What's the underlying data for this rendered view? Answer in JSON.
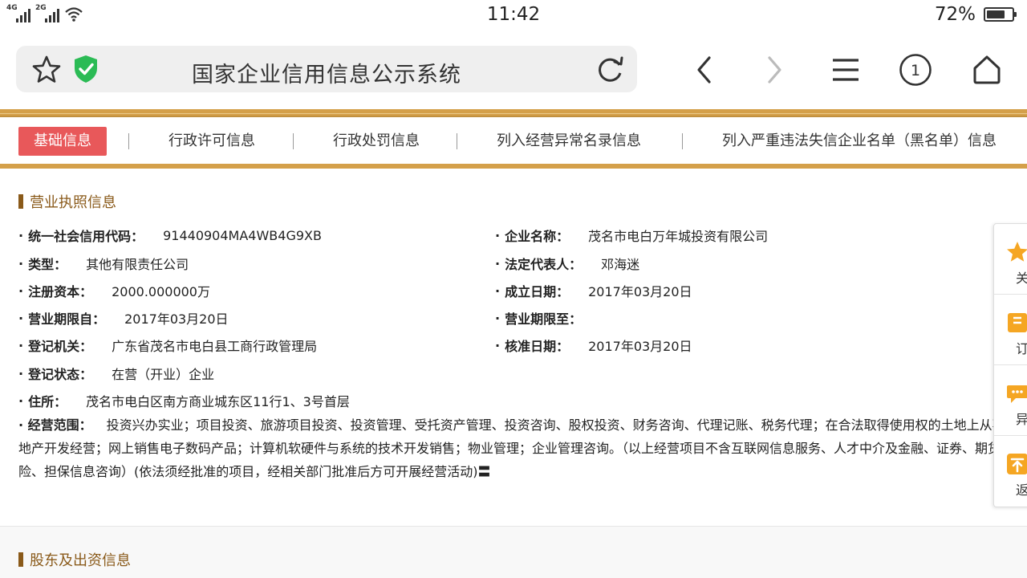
{
  "status_bar": {
    "net1": "4G",
    "net2": "2G",
    "time": "11:42",
    "battery_pct": "72%",
    "battery_level": 0.72
  },
  "browser": {
    "title": "国家企业信用信息公示系统",
    "tab_count": "1",
    "icons": [
      "star-icon",
      "shield-check-icon",
      "reload-icon",
      "back-icon",
      "forward-icon",
      "menu-icon",
      "tabs-count-icon",
      "home-icon"
    ]
  },
  "tabs": [
    {
      "label": "基础信息",
      "active": true
    },
    {
      "label": "行政许可信息",
      "active": false
    },
    {
      "label": "行政处罚信息",
      "active": false
    },
    {
      "label": "列入经营异常名录信息",
      "active": false
    },
    {
      "label": "列入严重违法失信企业名单（黑名单）信息",
      "active": false
    }
  ],
  "license": {
    "section_title": "营业执照信息",
    "fields": [
      {
        "label": "统一社会信用代码：",
        "value": "91440904MA4WB4G9XB"
      },
      {
        "label": "企业名称：",
        "value": "茂名市电白万年城投资有限公司"
      },
      {
        "label": "类型：",
        "value": "其他有限责任公司"
      },
      {
        "label": "法定代表人：",
        "value": "邓海迷"
      },
      {
        "label": "注册资本：",
        "value": "2000.000000万"
      },
      {
        "label": "成立日期：",
        "value": "2017年03月20日"
      },
      {
        "label": "营业期限自：",
        "value": "2017年03月20日"
      },
      {
        "label": "营业期限至：",
        "value": ""
      },
      {
        "label": "登记机关：",
        "value": "广东省茂名市电白县工商行政管理局"
      },
      {
        "label": "核准日期：",
        "value": "2017年03月20日"
      },
      {
        "label": "登记状态：",
        "value": "在营（开业）企业"
      },
      {
        "label": "住所：",
        "value": "茂名市电白区南方商业城东区11行1、3号首层"
      }
    ],
    "scope_label": "经营范围：",
    "scope_value": "投资兴办实业；项目投资、旅游项目投资、投资管理、受托资产管理、投资咨询、股权投资、财务咨询、代理记账、税务代理；在合法取得使用权的土地上从事房地产开发经营；网上销售电子数码产品；计算机软硬件与系统的技术开发销售；物业管理；企业管理咨询。（以上经营项目不含互联网信息服务、人才中介及金融、证券、期货、保险、担保信息咨询）(依法须经批准的项目，经相关部门批准后方可开展经营活动)〓"
  },
  "shareholder": {
    "section_title": "股东及出资信息"
  },
  "side_panel": [
    {
      "label": "关",
      "icon": "star-icon"
    },
    {
      "label": "订",
      "icon": "bookmark-icon"
    },
    {
      "label": "异",
      "icon": "comment-icon"
    },
    {
      "label": "返",
      "icon": "return-top-icon"
    }
  ],
  "colors": {
    "gold": "#d4a04a",
    "active_tab": "#e8585a",
    "section": "#8a5a1a",
    "shield": "#2bbb55",
    "side_icon": "#f5a623"
  }
}
